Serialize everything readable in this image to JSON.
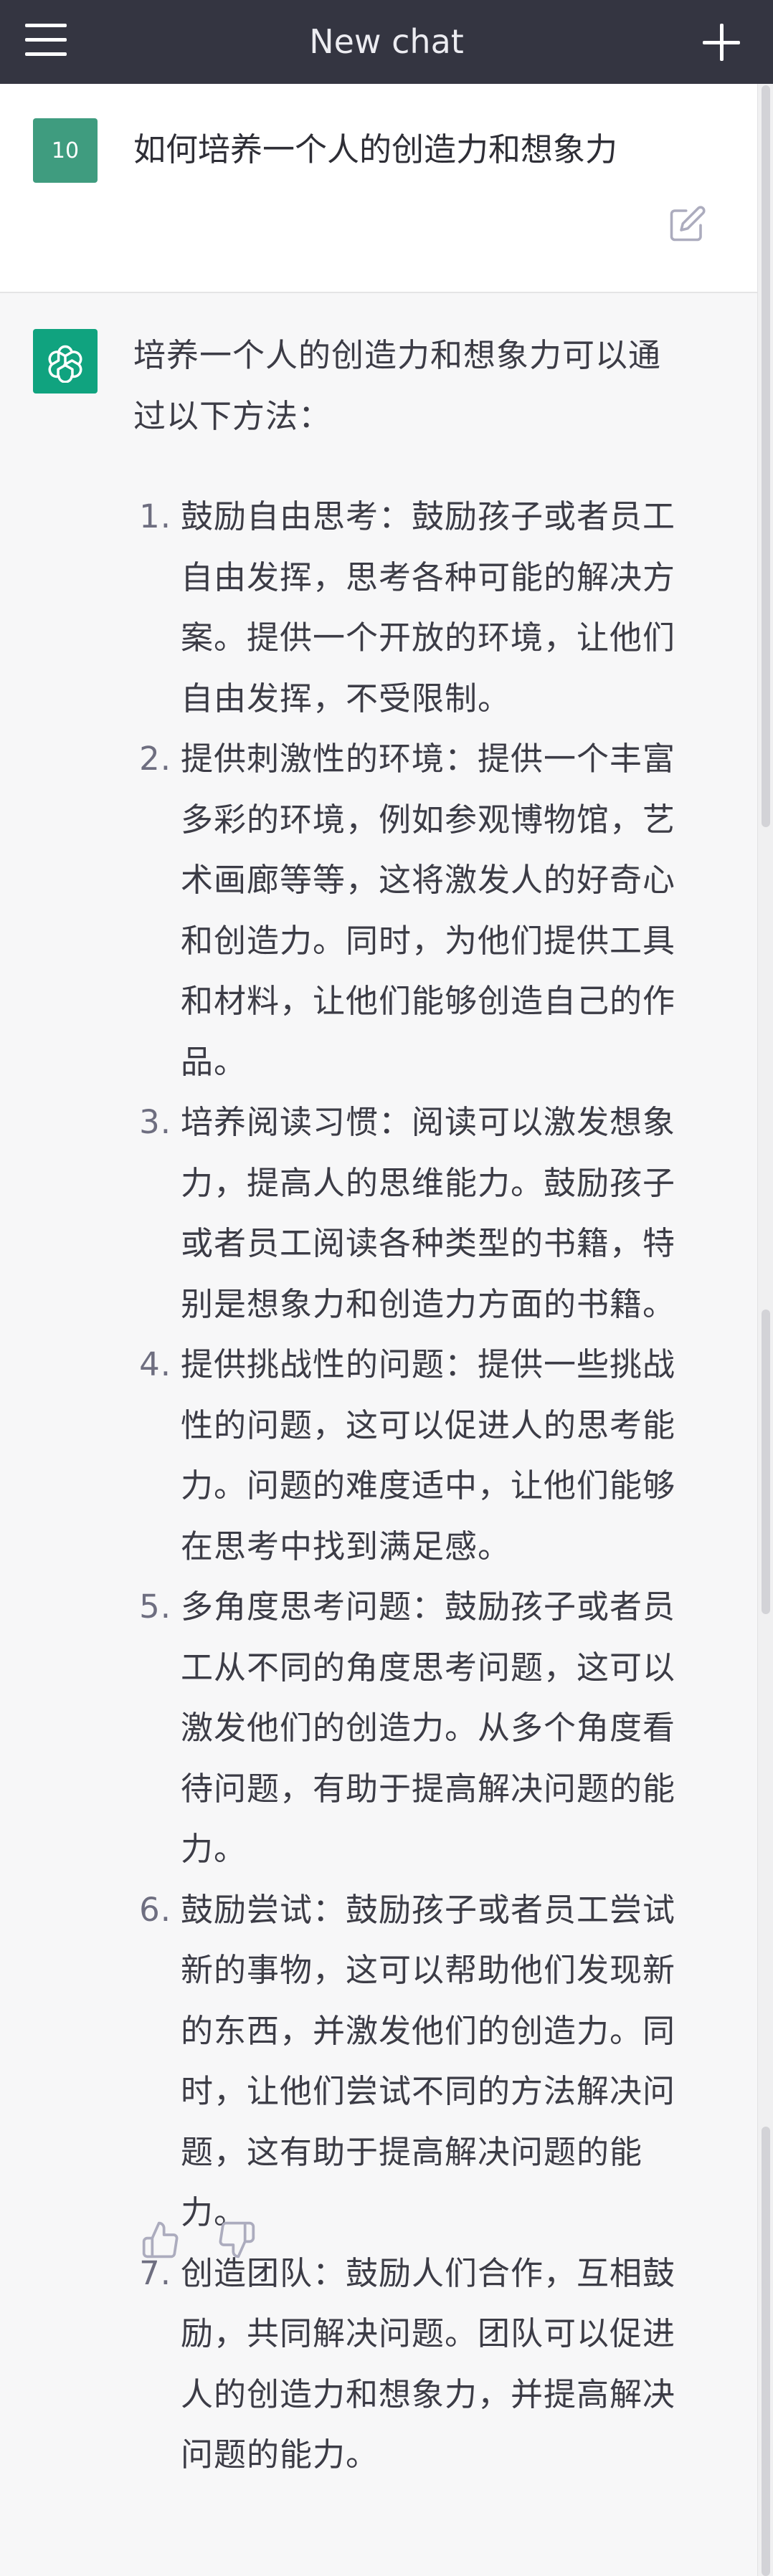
{
  "header": {
    "title": "New chat"
  },
  "user_message": {
    "avatar_text": "10",
    "text": "如何培养一个人的创造力和想象力"
  },
  "bot_message": {
    "intro_line1": "培养一个人的创造力和想象力可以通",
    "intro_line2": "过以下方法：",
    "items": [
      {
        "number": "1.",
        "lines": [
          "鼓励自由思考：鼓励孩子或者员工",
          "自由发挥，思考各种可能的解决方",
          "案。提供一个开放的环境，让他们",
          "自由发挥，不受限制。"
        ]
      },
      {
        "number": "2.",
        "lines": [
          "提供刺激性的环境：提供一个丰富",
          "多彩的环境，例如参观博物馆，艺",
          "术画廊等等，这将激发人的好奇心",
          "和创造力。同时，为他们提供工具",
          "和材料，让他们能够创造自己的作",
          "品。"
        ]
      },
      {
        "number": "3.",
        "lines": [
          "培养阅读习惯：阅读可以激发想象",
          "力，提高人的思维能力。鼓励孩子",
          "或者员工阅读各种类型的书籍，特",
          "别是想象力和创造力方面的书籍。"
        ]
      },
      {
        "number": "4.",
        "lines": [
          "提供挑战性的问题：提供一些挑战",
          "性的问题，这可以促进人的思考能",
          "力。问题的难度适中，让他们能够",
          "在思考中找到满足感。"
        ]
      },
      {
        "number": "5.",
        "lines": [
          "多角度思考问题：鼓励孩子或者员",
          "工从不同的角度思考问题，这可以",
          "激发他们的创造力。从多个角度看",
          "待问题，有助于提高解决问题的能",
          "力。"
        ]
      },
      {
        "number": "6.",
        "lines": [
          "鼓励尝试：鼓励孩子或者员工尝试",
          "新的事物，这可以帮助他们发现新",
          "的东西，并激发他们的创造力。同",
          "时，让他们尝试不同的方法解决问",
          "题，这有助于提高解决问题的能",
          "力。"
        ]
      },
      {
        "number": "7.",
        "lines": [
          "创造团队：鼓励人们合作，互相鼓",
          "励，共同解决问题。团队可以促进",
          "人的创造力和想象力，并提高解决",
          "问题的能力。"
        ]
      }
    ]
  },
  "icons": {
    "menu": "hamburger-menu-icon",
    "new_chat": "plus-icon",
    "edit": "edit-icon",
    "bot_avatar": "openai-logo-icon",
    "thumbs_up": "thumbs-up-icon",
    "thumbs_down": "thumbs-down-icon"
  },
  "colors": {
    "header_bg": "#343541",
    "user_avatar_bg": "#3f9c7f",
    "bot_avatar_bg": "#10a37f",
    "bot_bg": "#f7f7f8",
    "user_bg": "#ffffff"
  }
}
